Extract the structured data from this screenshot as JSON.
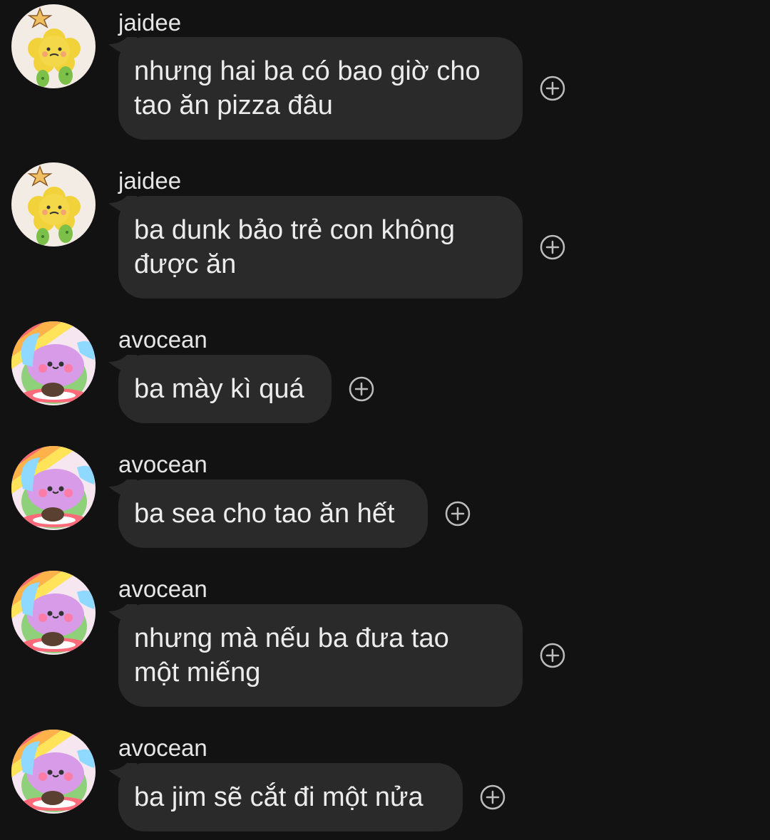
{
  "messages": [
    {
      "sender": "jaidee",
      "avatar": "cookie-flower-avatar",
      "lines": [
        "nhưng hai ba có bao giờ cho",
        "tao ăn pizza đâu"
      ]
    },
    {
      "sender": "jaidee",
      "avatar": "cookie-flower-avatar",
      "lines": [
        "ba dunk bảo trẻ con không",
        "được ăn"
      ]
    },
    {
      "sender": "avocean",
      "avatar": "rainbow-bunny-avatar",
      "lines": [
        "ba mày kì quá"
      ]
    },
    {
      "sender": "avocean",
      "avatar": "rainbow-bunny-avatar",
      "lines": [
        "ba sea cho tao ăn hết"
      ]
    },
    {
      "sender": "avocean",
      "avatar": "rainbow-bunny-avatar",
      "lines": [
        "nhưng mà nếu ba đưa tao",
        "một miếng"
      ]
    },
    {
      "sender": "avocean",
      "avatar": "rainbow-bunny-avatar",
      "lines": [
        "ba jim sẽ cắt đi một nửa"
      ]
    }
  ],
  "icons": {
    "react": "add-reaction-icon"
  },
  "colors": {
    "background": "#121212",
    "bubble": "#2a2a2b",
    "text": "#ececec",
    "icon": "#bdbdbd"
  }
}
